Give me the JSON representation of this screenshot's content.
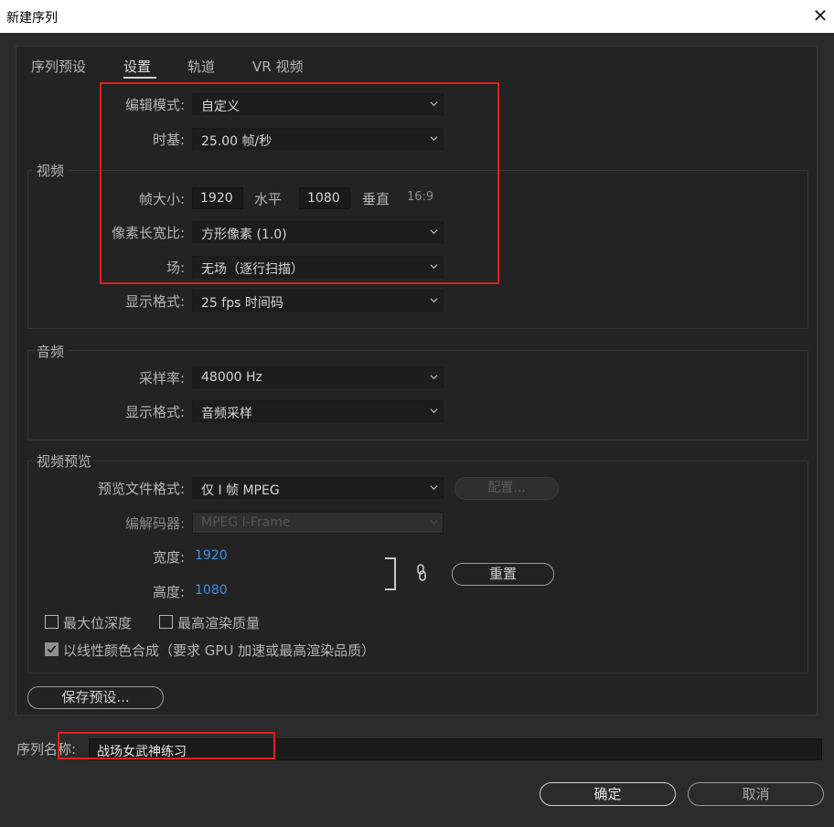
{
  "window": {
    "title": "新建序列"
  },
  "tabs": [
    {
      "label": "序列预设",
      "active": false
    },
    {
      "label": "设置",
      "active": true
    },
    {
      "label": "轨道",
      "active": false
    },
    {
      "label": "VR 视频",
      "active": false
    }
  ],
  "settings": {
    "editing_mode": {
      "label": "编辑模式:",
      "value": "自定义"
    },
    "timebase": {
      "label": "时基:",
      "value": "25.00  帧/秒"
    }
  },
  "video": {
    "group_label": "视频",
    "frame_size": {
      "label": "帧大小:",
      "width": "1920",
      "horizontal_label": "水平",
      "height": "1080",
      "vertical_label": "垂直",
      "ratio": "16:9"
    },
    "pixel_aspect": {
      "label": "像素长宽比:",
      "value": "方形像素 (1.0)"
    },
    "fields": {
      "label": "场:",
      "value": "无场（逐行扫描）"
    },
    "display_format": {
      "label": "显示格式:",
      "value": "25 fps 时间码"
    }
  },
  "audio": {
    "group_label": "音频",
    "sample_rate": {
      "label": "采样率:",
      "value": "48000 Hz"
    },
    "display_format": {
      "label": "显示格式:",
      "value": "音频采样"
    }
  },
  "video_preview": {
    "group_label": "视频预览",
    "file_format": {
      "label": "预览文件格式:",
      "value": "仅 I 帧 MPEG"
    },
    "configure_label": "配置...",
    "codec": {
      "label": "编解码器:",
      "value": "MPEG I-Frame"
    },
    "width": {
      "label": "宽度:",
      "value": "1920"
    },
    "height": {
      "label": "高度:",
      "value": "1080"
    },
    "reset_label": "重置",
    "max_bit_depth": {
      "label": "最大位深度",
      "checked": false
    },
    "max_render_quality": {
      "label": "最高渲染质量",
      "checked": false
    },
    "linear_color": {
      "label": "以线性颜色合成（要求 GPU 加速或最高渲染品质）",
      "checked": true
    }
  },
  "save_preset_label": "保存预设...",
  "sequence_name": {
    "label": "序列名称:",
    "value": "战场女武神练习"
  },
  "footer": {
    "ok_label": "确定",
    "cancel_label": "取消"
  },
  "colors": {
    "highlight_red": "#e01f1f",
    "link_blue": "#3f8ee6",
    "panel_bg": "#232323"
  }
}
